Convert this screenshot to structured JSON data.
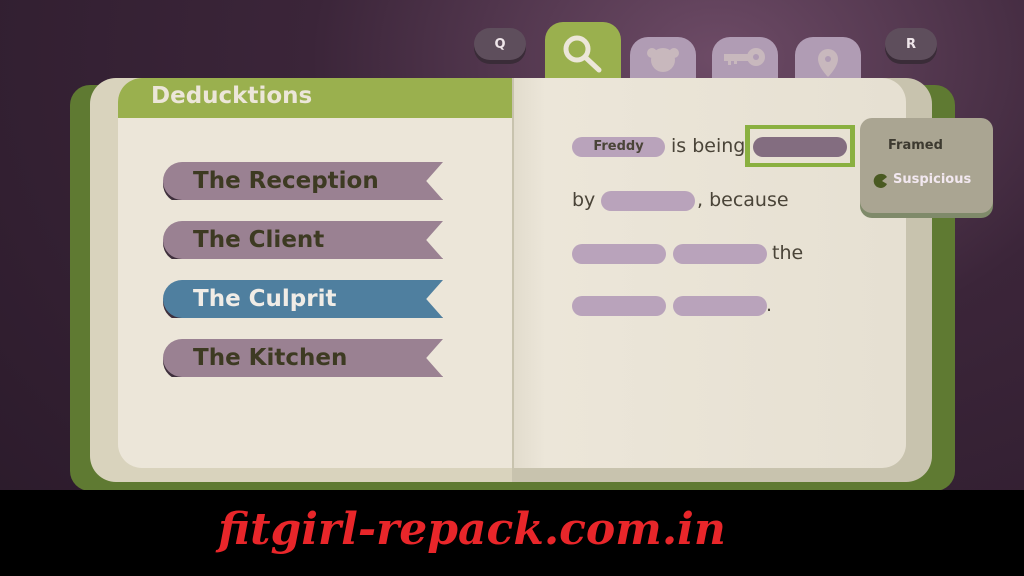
{
  "toolbar": {
    "prev_key": "Q",
    "next_key": "R",
    "tabs": [
      {
        "icon": "magnifier-icon",
        "active": true
      },
      {
        "icon": "teddy-bear-icon",
        "active": false
      },
      {
        "icon": "key-icon",
        "active": false
      },
      {
        "icon": "map-pin-icon",
        "active": false
      }
    ]
  },
  "left_page": {
    "title": "Deducktions",
    "items": [
      {
        "label": "The Reception",
        "selected": false
      },
      {
        "label": "The Client",
        "selected": false
      },
      {
        "label": "The Culprit",
        "selected": true
      },
      {
        "label": "The Kitchen",
        "selected": false
      }
    ]
  },
  "right_page": {
    "subject": "Freddy",
    "phrase1": "is being",
    "phrase2": "by",
    "phrase3": ", because",
    "phrase4": "the",
    "phrase5": "."
  },
  "dropdown": {
    "options": [
      "Framed",
      "Suspicious"
    ],
    "highlighted": "Suspicious"
  },
  "watermark": "fitgirl-repack.com.in",
  "colors": {
    "accent_green": "#9ab04e",
    "ribbon": "#9a8192",
    "ribbon_selected": "#4f7f9f",
    "blank": "#b9a3bb",
    "watermark": "#e8262a"
  }
}
